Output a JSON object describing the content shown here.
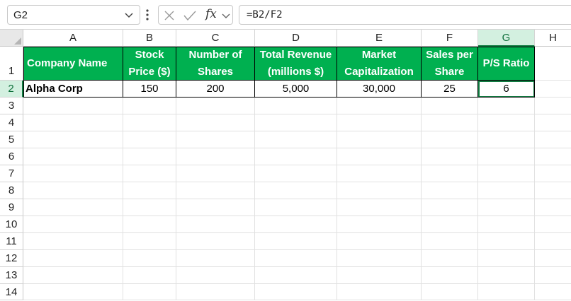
{
  "name_box": {
    "value": "G2"
  },
  "formula_bar": {
    "fx_label": "fx",
    "formula": "=B2/F2"
  },
  "columns": [
    "A",
    "B",
    "C",
    "D",
    "E",
    "F",
    "G",
    "H"
  ],
  "rows": [
    "1",
    "2",
    "3",
    "4",
    "5",
    "6",
    "7",
    "8",
    "9",
    "10",
    "11",
    "12",
    "13",
    "14"
  ],
  "headers": {
    "company_name": "Company Name",
    "stock_price": [
      "Stock",
      "Price ($)"
    ],
    "number_of_shares": [
      "Number of",
      "Shares"
    ],
    "total_revenue": [
      "Total Revenue",
      "(millions $)"
    ],
    "market_cap": [
      "Market",
      "Capitalization"
    ],
    "sales_per_share": [
      "Sales per",
      "Share"
    ],
    "ps_ratio": "P/S Ratio"
  },
  "data_row": {
    "company": "Alpha Corp",
    "stock_price": "150",
    "shares": "200",
    "revenue": "5,000",
    "market_cap": "30,000",
    "sales_per_share": "25",
    "ps_ratio": "6"
  },
  "colors": {
    "header_fill": "#00b050",
    "selection": "#107c41"
  }
}
